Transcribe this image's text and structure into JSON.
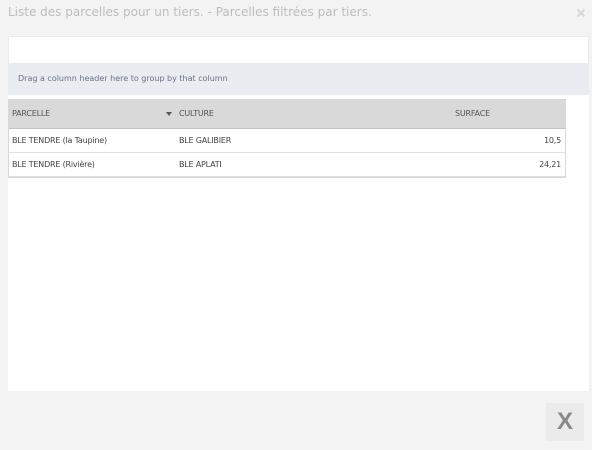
{
  "window": {
    "title": "Liste des parcelles pour un tiers. - Parcelles filtrées par tiers."
  },
  "grid": {
    "group_panel_text": "Drag a column header here to group by that column",
    "columns": [
      "PARCELLE",
      "CULTURE",
      "SURFACE"
    ],
    "sorted_column": "PARCELLE",
    "rows": [
      {
        "parcelle": "BLE TENDRE (la Taupine)",
        "culture": "BLE GALIBIER",
        "surface": "10,5"
      },
      {
        "parcelle": "BLE TENDRE (Rivière)",
        "culture": "BLE APLATI",
        "surface": "24,21"
      }
    ]
  },
  "footer": {
    "close_label": "X"
  }
}
